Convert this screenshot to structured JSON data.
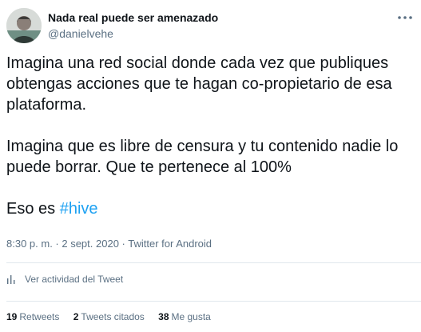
{
  "tweet": {
    "author": {
      "display_name": "Nada real puede ser amenazado",
      "handle": "@danielvehe"
    },
    "more_icon": "more-horizontal-icon",
    "paragraphs": [
      "Imagina una red social donde cada vez que publiques obtengas acciones que te hagan co-propietario de esa plataforma.",
      "Imagina que es libre de censura y tu contenido nadie lo puede borrar. Que te pertenece al 100%"
    ],
    "last_line_prefix": "Eso es ",
    "hashtag": "#hive",
    "timestamp": "8:30 p. m. · 2 sept. 2020 · Twitter for Android",
    "activity_label": "Ver actividad del Tweet",
    "activity_icon": "bar-chart-icon",
    "stats": {
      "retweets_count": "19",
      "retweets_label": "Retweets",
      "quotes_count": "2",
      "quotes_label": "Tweets citados",
      "likes_count": "38",
      "likes_label": "Me gusta"
    },
    "colors": {
      "text": "#0f1419",
      "secondary": "#5b7083",
      "link": "#1da1f2",
      "border": "#e1e8ed"
    }
  }
}
